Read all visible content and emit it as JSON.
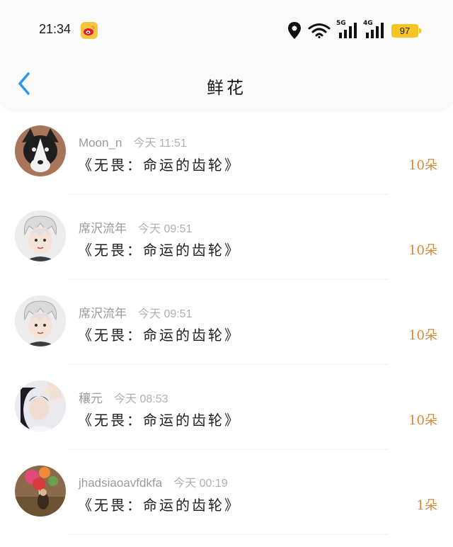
{
  "status_bar": {
    "time": "21:34",
    "app_icon": "weibo-icon",
    "network_5g": "5G",
    "network_4g": "4G",
    "battery": "97"
  },
  "nav": {
    "back_icon": "chevron-left-icon",
    "title": "鲜花"
  },
  "colors": {
    "accent_blue": "#2b97e6",
    "count_orange": "#d4863a",
    "battery_yellow": "#f6c523"
  },
  "items": [
    {
      "name": "Moon_n",
      "time": "今天 11:51",
      "gift": "《无畏：命运的齿轮》",
      "count": "10朵"
    },
    {
      "name": "席沢流年",
      "time": "今天 09:51",
      "gift": "《无畏：命运的齿轮》",
      "count": "10朵"
    },
    {
      "name": "席沢流年",
      "time": "今天 09:51",
      "gift": "《无畏：命运的齿轮》",
      "count": "10朵"
    },
    {
      "name": "穰元",
      "time": "今天 08:53",
      "gift": "《无畏：命运的齿轮》",
      "count": "10朵"
    },
    {
      "name": "jhadsiaoavfdkfa",
      "time": "今天 00:19",
      "gift": "《无畏：命运的齿轮》",
      "count": "1朵"
    }
  ]
}
